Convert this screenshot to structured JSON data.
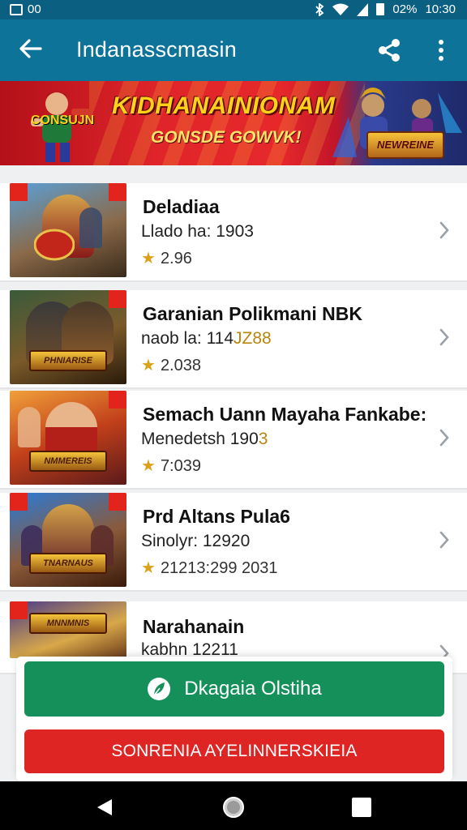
{
  "status_bar": {
    "left_text": "00",
    "battery": "02%",
    "time": "10:30"
  },
  "app_bar": {
    "title": "Indanasscmasin"
  },
  "banner": {
    "headline": "KIDHANAINIONAM",
    "subline": "GONSDE GOWVK!",
    "left_tag": "CONSUJN",
    "right_logo": "NEWREINE"
  },
  "list": {
    "items": [
      {
        "title": "Deladiaa",
        "subtitle": "Llado ha: 1903",
        "subtitle_hl": "",
        "rating": "2.96",
        "plate": ""
      },
      {
        "title": "Garanian Polikmani NBK",
        "subtitle": "naob la: 114",
        "subtitle_hl": "JZ88",
        "rating": "2.038",
        "plate": "PHNIARISE"
      },
      {
        "title": "Semach Uann Mayaha Fankabe:",
        "subtitle": "Menedetsh 190",
        "subtitle_hl": "3",
        "rating": "7:039",
        "plate": "NMMEREIS"
      },
      {
        "title": "Prd Altans Pula6",
        "subtitle": "Sinolyr: 12920",
        "subtitle_hl": "",
        "rating": "21213:299 2031",
        "plate": "TNARNAUS"
      },
      {
        "title": "Narahanain",
        "subtitle": "kabhn 12211",
        "subtitle_hl": "",
        "rating": "",
        "plate": "MNNMNIS"
      }
    ]
  },
  "actions": {
    "primary_label": "Dkagaia Olstiha",
    "secondary_label": "SONRENIA AYELINNERSKIEIA"
  },
  "colors": {
    "status_bar": "#0b5f80",
    "app_bar": "#0e7399",
    "primary_button": "#16905a",
    "secondary_button": "#df2424",
    "star": "#d9a21a"
  },
  "icons": [
    "back-arrow-icon",
    "share-icon",
    "more-vert-icon",
    "chevron-right-icon",
    "leaf-icon",
    "nav-back-icon",
    "nav-home-icon",
    "nav-recent-icon",
    "star-icon"
  ]
}
